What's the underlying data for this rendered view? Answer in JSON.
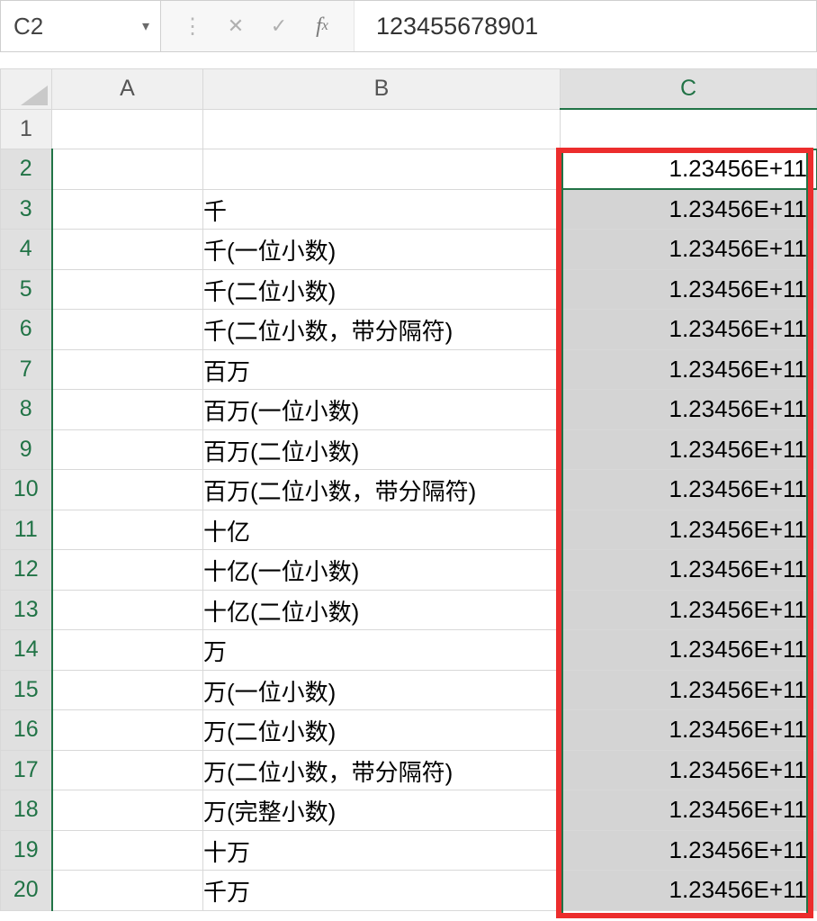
{
  "formula_bar": {
    "name_box": "C2",
    "formula_value": "123455678901"
  },
  "columns": {
    "a": "A",
    "b": "B",
    "c": "C"
  },
  "rows": [
    {
      "num": "1",
      "b": "",
      "c": ""
    },
    {
      "num": "2",
      "b": "",
      "c": "1.23456E+11",
      "active": true
    },
    {
      "num": "3",
      "b": "千",
      "c": "1.23456E+11"
    },
    {
      "num": "4",
      "b": "千(一位小数)",
      "c": "1.23456E+11"
    },
    {
      "num": "5",
      "b": "千(二位小数)",
      "c": "1.23456E+11"
    },
    {
      "num": "6",
      "b": "千(二位小数，带分隔符)",
      "c": "1.23456E+11"
    },
    {
      "num": "7",
      "b": "百万",
      "c": "1.23456E+11"
    },
    {
      "num": "8",
      "b": "百万(一位小数)",
      "c": "1.23456E+11"
    },
    {
      "num": "9",
      "b": "百万(二位小数)",
      "c": "1.23456E+11"
    },
    {
      "num": "10",
      "b": "百万(二位小数，带分隔符)",
      "c": "1.23456E+11"
    },
    {
      "num": "11",
      "b": "十亿",
      "c": "1.23456E+11"
    },
    {
      "num": "12",
      "b": "十亿(一位小数)",
      "c": "1.23456E+11"
    },
    {
      "num": "13",
      "b": "十亿(二位小数)",
      "c": "1.23456E+11"
    },
    {
      "num": "14",
      "b": "万",
      "c": "1.23456E+11"
    },
    {
      "num": "15",
      "b": "万(一位小数)",
      "c": "1.23456E+11"
    },
    {
      "num": "16",
      "b": "万(二位小数)",
      "c": "1.23456E+11"
    },
    {
      "num": "17",
      "b": "万(二位小数，带分隔符)",
      "c": "1.23456E+11"
    },
    {
      "num": "18",
      "b": "万(完整小数)",
      "c": "1.23456E+11"
    },
    {
      "num": "19",
      "b": "十万",
      "c": "1.23456E+11"
    },
    {
      "num": "20",
      "b": "千万",
      "c": "1.23456E+11"
    }
  ]
}
